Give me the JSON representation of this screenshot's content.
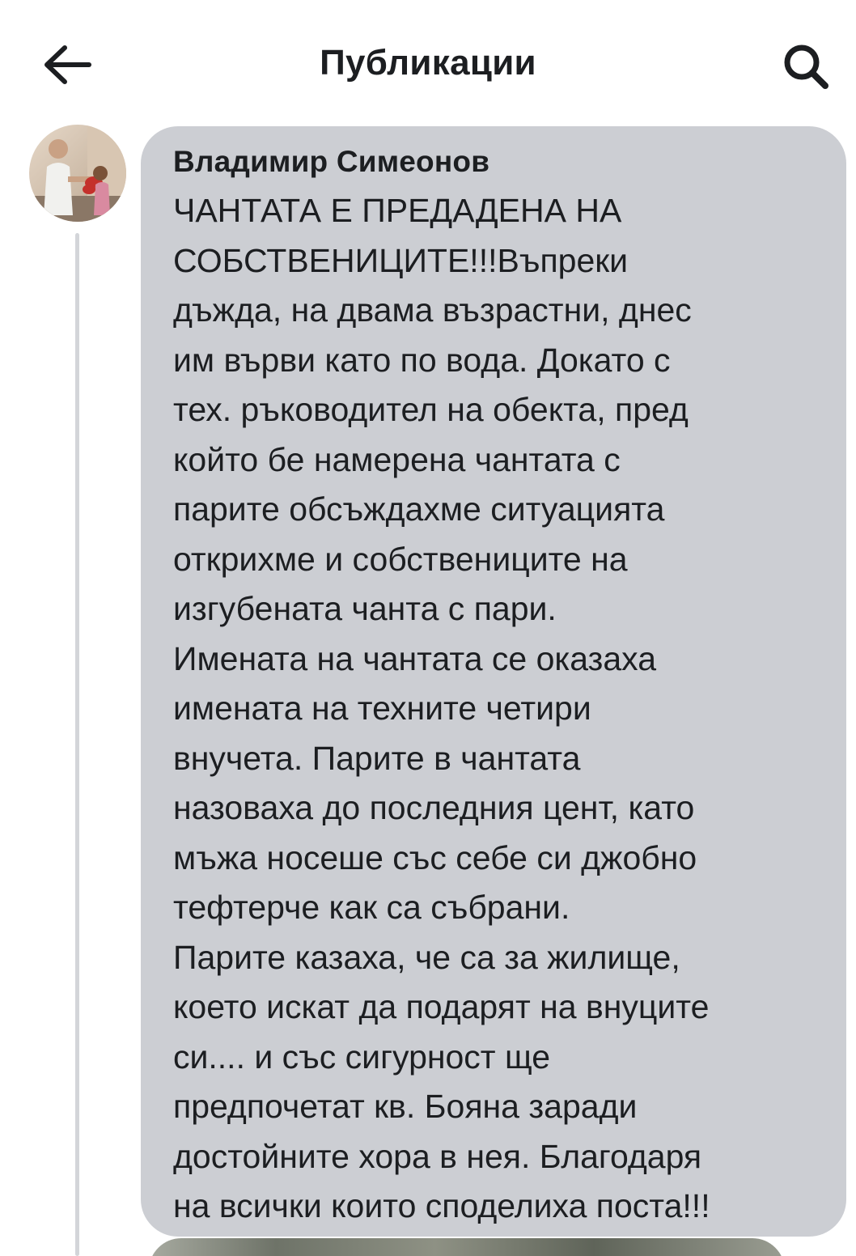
{
  "header": {
    "title": "Публикации",
    "back_icon": "arrow-left-icon",
    "search_icon": "search-icon"
  },
  "comment": {
    "author": "Владимир Симеонов",
    "lines": [
      "ЧАНТАТА Е ПРЕДАДЕНА НА",
      "СОБСТВЕНИЦИТЕ!!!Въпреки",
      "дъжда, на двама възрастни, днес",
      "им върви като по вода. Докато с",
      "тех. ръководител на обекта, пред",
      "който бе намерена чантата с",
      "парите обсъждахме ситуацията",
      "открихме и собствениците на",
      "изгубената чанта с пари.",
      "Имената на чантата се оказаха",
      "имената на техните четири",
      "внучета. Парите в чантата",
      "назоваха до последния цент, като",
      "мъжа носеше със себе си джобно",
      "тефтерче как са събрани.",
      "Парите казаха, че са за жилище,",
      "което искат да подарят на внуците",
      "си.... и със сигурност ще",
      "предпочетат кв. Бояна заради",
      "достойните хора в нея. Благодаря",
      "на всички които споделиха поста!!!"
    ]
  },
  "colors": {
    "bubble": "#ccced3",
    "text": "#1c1e21",
    "thread_line": "#d3d5d9",
    "background": "#ffffff"
  }
}
